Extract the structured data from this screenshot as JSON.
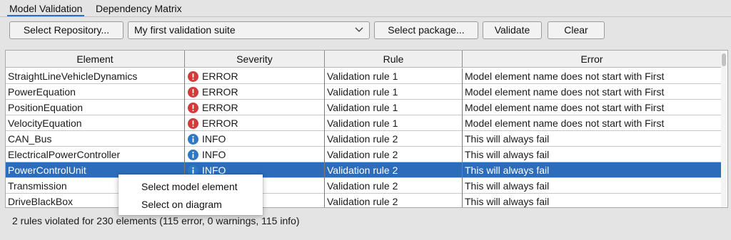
{
  "tabs": [
    {
      "label": "Model Validation",
      "active": true
    },
    {
      "label": "Dependency Matrix",
      "active": false
    }
  ],
  "toolbar": {
    "select_repository": "Select Repository...",
    "suite_selected": "My first validation suite",
    "select_package": "Select package...",
    "validate": "Validate",
    "clear": "Clear"
  },
  "table": {
    "headers": [
      "Element",
      "Severity",
      "Rule",
      "Error"
    ],
    "rows": [
      {
        "element": "StraightLineVehicleDynamics",
        "severity": "ERROR",
        "severity_icon": "error-icon",
        "rule": "Validation rule 1",
        "error": "Model element name does not start with First"
      },
      {
        "element": "PowerEquation",
        "severity": "ERROR",
        "severity_icon": "error-icon",
        "rule": "Validation rule 1",
        "error": "Model element name does not start with First"
      },
      {
        "element": "PositionEquation",
        "severity": "ERROR",
        "severity_icon": "error-icon",
        "rule": "Validation rule 1",
        "error": "Model element name does not start with First"
      },
      {
        "element": "VelocityEquation",
        "severity": "ERROR",
        "severity_icon": "error-icon",
        "rule": "Validation rule 1",
        "error": "Model element name does not start with First"
      },
      {
        "element": "CAN_Bus",
        "severity": "INFO",
        "severity_icon": "info-icon",
        "rule": "Validation rule 2",
        "error": "This will always fail"
      },
      {
        "element": "ElectricalPowerController",
        "severity": "INFO",
        "severity_icon": "info-icon",
        "rule": "Validation rule 2",
        "error": "This will always fail"
      },
      {
        "element": "PowerControlUnit",
        "severity": "INFO",
        "severity_icon": "info-icon",
        "rule": "Validation rule 2",
        "error": "This will always fail",
        "selected": true
      },
      {
        "element": "Transmission",
        "severity": "INFO",
        "severity_icon": "info-icon",
        "rule": "Validation rule 2",
        "error": "This will always fail"
      },
      {
        "element": "DriveBlackBox",
        "severity": "INFO",
        "severity_icon": "info-icon",
        "rule": "Validation rule 2",
        "error": "This will always fail"
      }
    ]
  },
  "context_menu": {
    "items": [
      "Select model element",
      "Select on diagram"
    ]
  },
  "status": "2 rules violated for 230 elements (115 error, 0 warnings, 115 info)",
  "colors": {
    "selection": "#2c6cba",
    "error": "#d23b3b",
    "info": "#2f78c4",
    "tab_underline": "#2c6fbe"
  }
}
